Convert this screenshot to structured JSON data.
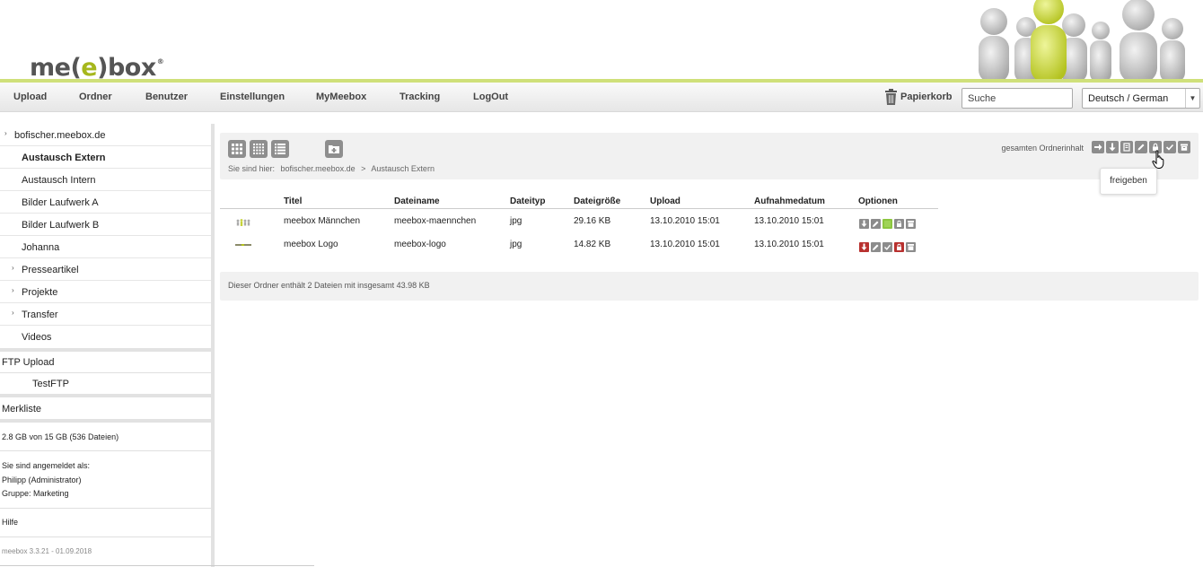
{
  "brand": {
    "logo_me": "me",
    "logo_open": "(",
    "logo_e": "e",
    "logo_close": ")",
    "logo_box": "box",
    "logo_reg": "®",
    "accent_color": "#a6b71c"
  },
  "nav": {
    "items": [
      "Upload",
      "Ordner",
      "Benutzer",
      "Einstellungen",
      "MyMeebox",
      "Tracking",
      "LogOut"
    ],
    "trash_label": "Papierkorb",
    "search_value": "Suche",
    "language": "Deutsch / German"
  },
  "sidebar": {
    "tree": [
      {
        "label": "bofischer.meebox.de",
        "expandable": true,
        "active": false
      },
      {
        "label": "Austausch Extern",
        "expandable": false,
        "active": true
      },
      {
        "label": "Austausch Intern",
        "expandable": false,
        "active": false
      },
      {
        "label": "Bilder Laufwerk A",
        "expandable": false,
        "active": false
      },
      {
        "label": "Bilder Laufwerk B",
        "expandable": false,
        "active": false
      },
      {
        "label": "Johanna",
        "expandable": false,
        "active": false
      },
      {
        "label": "Presseartikel",
        "expandable": true,
        "active": false
      },
      {
        "label": "Projekte",
        "expandable": true,
        "active": false
      },
      {
        "label": "Transfer",
        "expandable": true,
        "active": false
      },
      {
        "label": "Videos",
        "expandable": false,
        "active": false
      }
    ],
    "ftp_upload": "FTP Upload",
    "ftp_child": "TestFTP",
    "merkliste": "Merkliste",
    "storage": "2.8 GB von 15 GB (536 Dateien)",
    "login_heading": "Sie sind angemeldet als:",
    "login_user": "Philipp (Administrator)",
    "login_group": "Gruppe: Marketing",
    "help": "Hilfe",
    "version": "meebox 3.3.21 - 01.09.2018"
  },
  "toolbar": {
    "breadcrumb_prefix": "Sie sind hier:",
    "breadcrumb_root": "bofischer.meebox.de",
    "breadcrumb_sep": ">",
    "breadcrumb_current": "Austausch Extern",
    "folder_contents_label": "gesamten Ordnerinhalt",
    "tooltip": "freigeben"
  },
  "table": {
    "headers": [
      "Titel",
      "Dateiname",
      "Dateityp",
      "Dateigröße",
      "Upload",
      "Aufnahmedatum",
      "Optionen"
    ],
    "rows": [
      {
        "title": "meebox Männchen",
        "filename": "meebox-maennchen",
        "type": "jpg",
        "size": "29.16 KB",
        "upload": "13.10.2010 15:01",
        "taken": "13.10.2010 15:01"
      },
      {
        "title": "meebox Logo",
        "filename": "meebox-logo",
        "type": "jpg",
        "size": "14.82 KB",
        "upload": "13.10.2010 15:01",
        "taken": "13.10.2010 15:01"
      }
    ]
  },
  "summary": "Dieser Ordner enthält 2 Dateien mit insgesamt 43.98 KB"
}
